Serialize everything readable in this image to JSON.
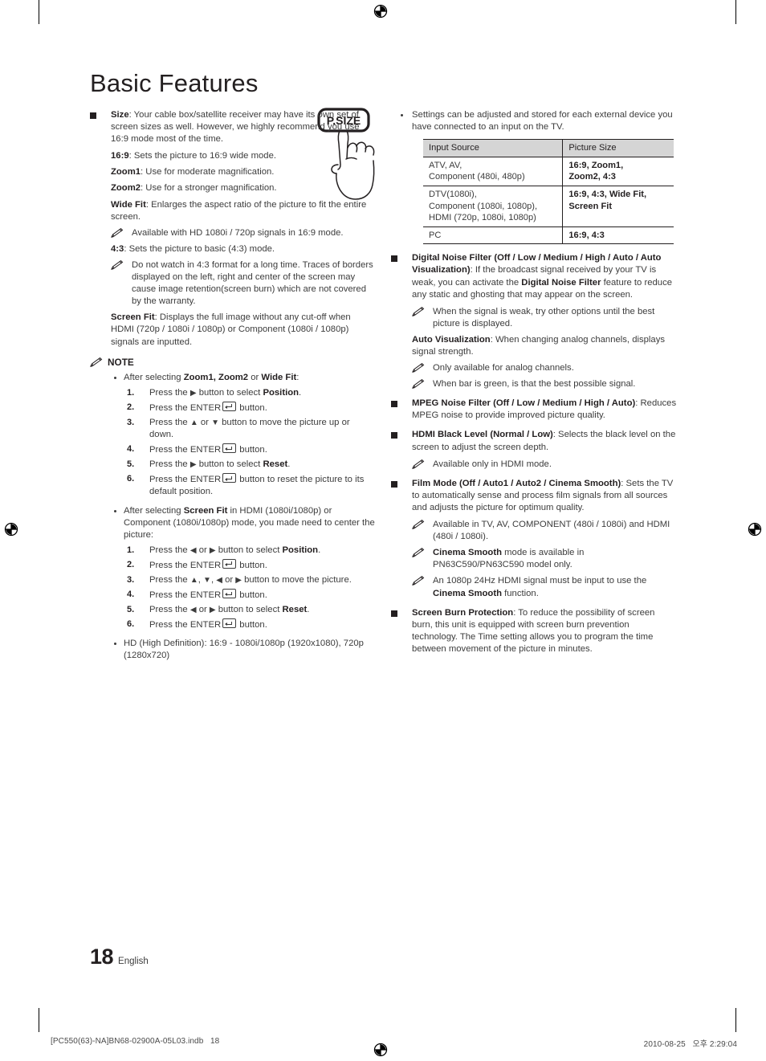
{
  "page": {
    "title": "Basic Features",
    "folio_number": "18",
    "folio_language": "English",
    "imprint_left": "[PC550(63)-NA]BN68-02900A-05L03.indb   18",
    "imprint_right": "2010-08-25   오후 2:29:04"
  },
  "illustration": {
    "button_label": "P.SIZE",
    "alt": "hand pressing the P.SIZE remote control button"
  },
  "left_column": {
    "size_item": {
      "term": "Size",
      "text": ": Your cable box/satellite receiver may have its own set of screen sizes as well. However, we highly recommend you use 16:9 mode most of the time."
    },
    "modes": [
      {
        "term": "16:9",
        "text": ": Sets the picture to 16:9 wide mode."
      },
      {
        "term": "Zoom1",
        "text": ": Use for moderate magnification."
      },
      {
        "term": "Zoom2",
        "text": ": Use for a stronger magnification."
      },
      {
        "term": "Wide Fit",
        "text": ": Enlarges the aspect ratio of the picture to fit the entire screen."
      }
    ],
    "wide_fit_note": "Available with HD 1080i / 720p signals in 16:9 mode.",
    "mode_43": {
      "term": "4:3",
      "text": ": Sets the picture to basic (4:3) mode."
    },
    "note_43": "Do not watch in 4:3 format for a long time. Traces of borders displayed on the left, right and center of the screen may cause image retention(screen burn) which are not covered by the warranty.",
    "screen_fit": {
      "term": "Screen Fit",
      "text": ": Displays the full image without any cut-off when HDMI (720p / 1080i / 1080p) or Component (1080i / 1080p) signals are inputted."
    },
    "note_heading": "NOTE",
    "note_groups": [
      {
        "lead_pre": "After selecting ",
        "lead_bold": "Zoom1, Zoom2",
        "lead_mid": " or ",
        "lead_bold2": "Wide Fit",
        "lead_post": ":",
        "steps": [
          {
            "num": "1.",
            "pre": "Press the ",
            "arrow": "▶",
            "mid": " button to select ",
            "bold": "Position",
            "post": "."
          },
          {
            "num": "2.",
            "pre": "Press the ENTER",
            "key": true,
            "post_text": " button."
          },
          {
            "num": "3.",
            "pre": "Press the ",
            "arrow": "▲",
            "mid": " or ",
            "arrow2": "▼",
            "post_text": " button to move the picture up or down."
          },
          {
            "num": "4.",
            "pre": "Press the ENTER",
            "key": true,
            "post_text": " button."
          },
          {
            "num": "5.",
            "pre": "Press the ",
            "arrow": "▶",
            "mid": " button to select ",
            "bold": "Reset",
            "post": "."
          },
          {
            "num": "6.",
            "pre": "Press the ENTER",
            "key": true,
            "post_text": " button to reset the picture to its default position."
          }
        ]
      },
      {
        "lead_pre": "After selecting ",
        "lead_bold": "Screen Fit",
        "lead_post": " in HDMI (1080i/1080p) or Component (1080i/1080p) mode, you made need to center the picture:",
        "steps": [
          {
            "num": "1.",
            "pre": "Press the ",
            "arrow": "◀",
            "mid": " or ",
            "arrow2": "▶",
            "mid2": " button to select ",
            "bold": "Position",
            "post": "."
          },
          {
            "num": "2.",
            "pre": "Press the ENTER",
            "key": true,
            "post_text": " button."
          },
          {
            "num": "3.",
            "pre": "Press the ",
            "arrow": "▲",
            "mid": ", ",
            "arrow2": "▼",
            "mid2": ", ",
            "arrow3": "◀",
            "mid3": " or ",
            "arrow4": "▶",
            "post_text": " button to move the picture."
          },
          {
            "num": "4.",
            "pre": "Press the ENTER",
            "key": true,
            "post_text": " button."
          },
          {
            "num": "5.",
            "pre": "Press the ",
            "arrow": "◀",
            "mid": " or ",
            "arrow2": "▶",
            "mid2": " button to select ",
            "bold": "Reset",
            "post": "."
          },
          {
            "num": "6.",
            "pre": "Press the ENTER",
            "key": true,
            "post_text": " button."
          }
        ]
      }
    ],
    "hd_note": "HD (High Definition): 16:9 - 1080i/1080p (1920x1080), 720p (1280x720)"
  },
  "right_column": {
    "settings_bullet": "Settings can be adjusted and stored for each external device you have connected to an input on the TV.",
    "table": {
      "headers": [
        "Input Source",
        "Picture Size"
      ],
      "rows": [
        {
          "input": "ATV, AV,\nComponent (480i, 480p)",
          "size": "16:9, Zoom1,\nZoom2, 4:3"
        },
        {
          "input": "DTV(1080i),\nComponent (1080i, 1080p),\nHDMI (720p, 1080i, 1080p)",
          "size": "16:9, 4:3, Wide Fit,\nScreen Fit"
        },
        {
          "input": "PC",
          "size": "16:9, 4:3"
        }
      ]
    },
    "digital_noise_filter": {
      "term": "Digital Noise Filter (Off / Low / Medium / High / Auto / Auto Visualization)",
      "text1": ": If the broadcast signal received by your TV is weak, you can activate the ",
      "bold2": "Digital Noise Filter",
      "text2": " feature to reduce any static and ghosting that may appear on the screen.",
      "note": "When the signal is weak, try other options until the best picture is displayed."
    },
    "auto_visualization": {
      "term": "Auto Visualization",
      "text": ": When changing analog channels, displays signal strength.",
      "notes": [
        "Only available for analog channels.",
        "When bar is green, is that the best possible signal."
      ]
    },
    "mpeg_noise_filter": {
      "term": "MPEG Noise Filter (Off / Low / Medium / High / Auto)",
      "text": ": Reduces MPEG noise to provide improved picture quality."
    },
    "hdmi_black_level": {
      "term": "HDMI Black Level (Normal / Low)",
      "text": ": Selects the black level on the screen to adjust the screen depth.",
      "note": "Available only in HDMI mode."
    },
    "film_mode": {
      "term": "Film Mode (Off / Auto1 / Auto2 / Cinema Smooth)",
      "text": ": Sets the TV to automatically sense and process film signals from all sources and adjusts the picture for optimum quality.",
      "note1": "Available in TV, AV, COMPONENT (480i / 1080i) and HDMI (480i / 1080i).",
      "note2_bold": "Cinema Smooth",
      "note2_text": " mode is available in PN63C590/PN63C590 model only.",
      "note3_pre": "An 1080p 24Hz HDMI signal must be input to use the ",
      "note3_bold": "Cinema Smooth",
      "note3_post": " function."
    },
    "screen_burn_protection": {
      "term": "Screen Burn Protection",
      "text": ": To reduce the possibility of screen burn, this unit is equipped with screen burn prevention technology. The Time setting allows you to program the time between movement of the picture in minutes."
    }
  }
}
